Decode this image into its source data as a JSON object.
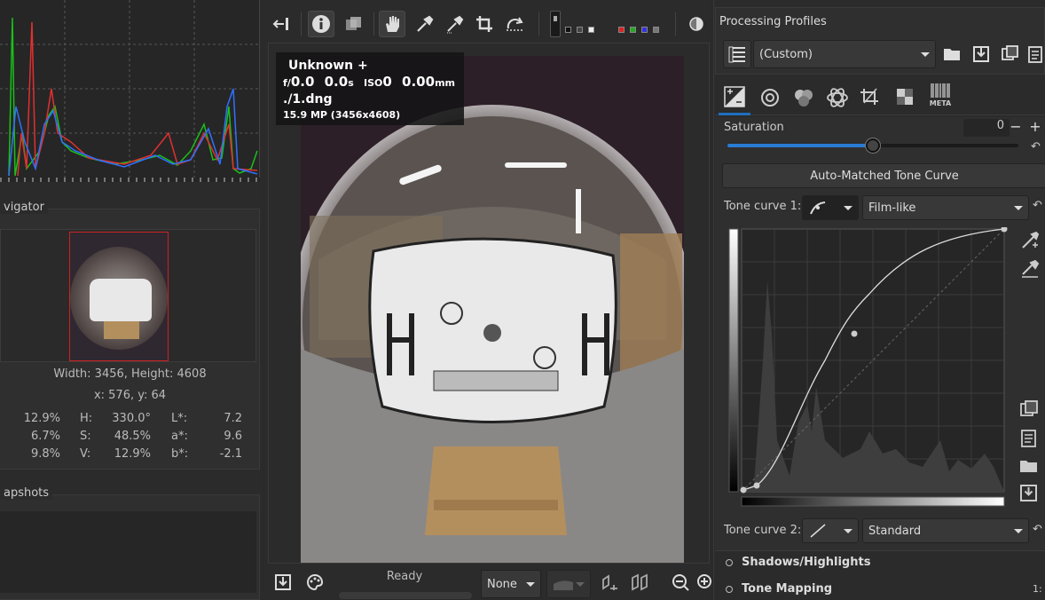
{
  "colors": {
    "bg": "#2a2a2a",
    "accent": "#1f6fbf",
    "slider_fill": "#2a7bd4"
  },
  "navigator": {
    "title": "vigator",
    "width_height": "Width: 3456, Height: 4608",
    "coords": "x: 576, y: 64",
    "rgb": [
      "12.9%",
      "6.7%",
      "9.8%"
    ],
    "hsv_labels": [
      "H:",
      "S:",
      "V:"
    ],
    "hsv_values": [
      "330.0°",
      "48.5%",
      "12.9%"
    ],
    "lab_labels": [
      "L*:",
      "a*:",
      "b*:"
    ],
    "lab_values": [
      "7.2",
      "9.6",
      "-2.1"
    ]
  },
  "snapshots": {
    "title": "apshots"
  },
  "image_info": {
    "camera": "Unknown +",
    "f_prefix": "f/",
    "f_value": "0.0",
    "shutter": "0.0",
    "shutter_unit": "s",
    "iso_label": "ISO",
    "iso_value": "0",
    "focal": "0.00",
    "focal_unit": "mm",
    "filename": "./1.dng",
    "megapixels": "15.9 MP (3456x4608)"
  },
  "bottom_bar": {
    "status": "Ready",
    "preview_mode": "None"
  },
  "profiles": {
    "title": "Processing Profiles",
    "current": "(Custom)"
  },
  "tool_tabs": [
    "exposure-icon",
    "detail-icon",
    "color-icon",
    "advanced-icon",
    "transform-icon",
    "raw-icon",
    "meta-icon"
  ],
  "meta_label": "META",
  "exposure": {
    "saturation_label": "Saturation",
    "saturation_value": "0",
    "saturation_level": 0.5,
    "auto_tone_button": "Auto-Matched Tone Curve",
    "tone_curve1_label": "Tone curve 1:",
    "tone_curve1_mode": "Film-like",
    "tone_curve2_label": "Tone curve 2:",
    "tone_curve2_mode": "Standard"
  },
  "sections": [
    "Shadows/Highlights",
    "Tone Mapping"
  ],
  "zoom_label": "1:"
}
